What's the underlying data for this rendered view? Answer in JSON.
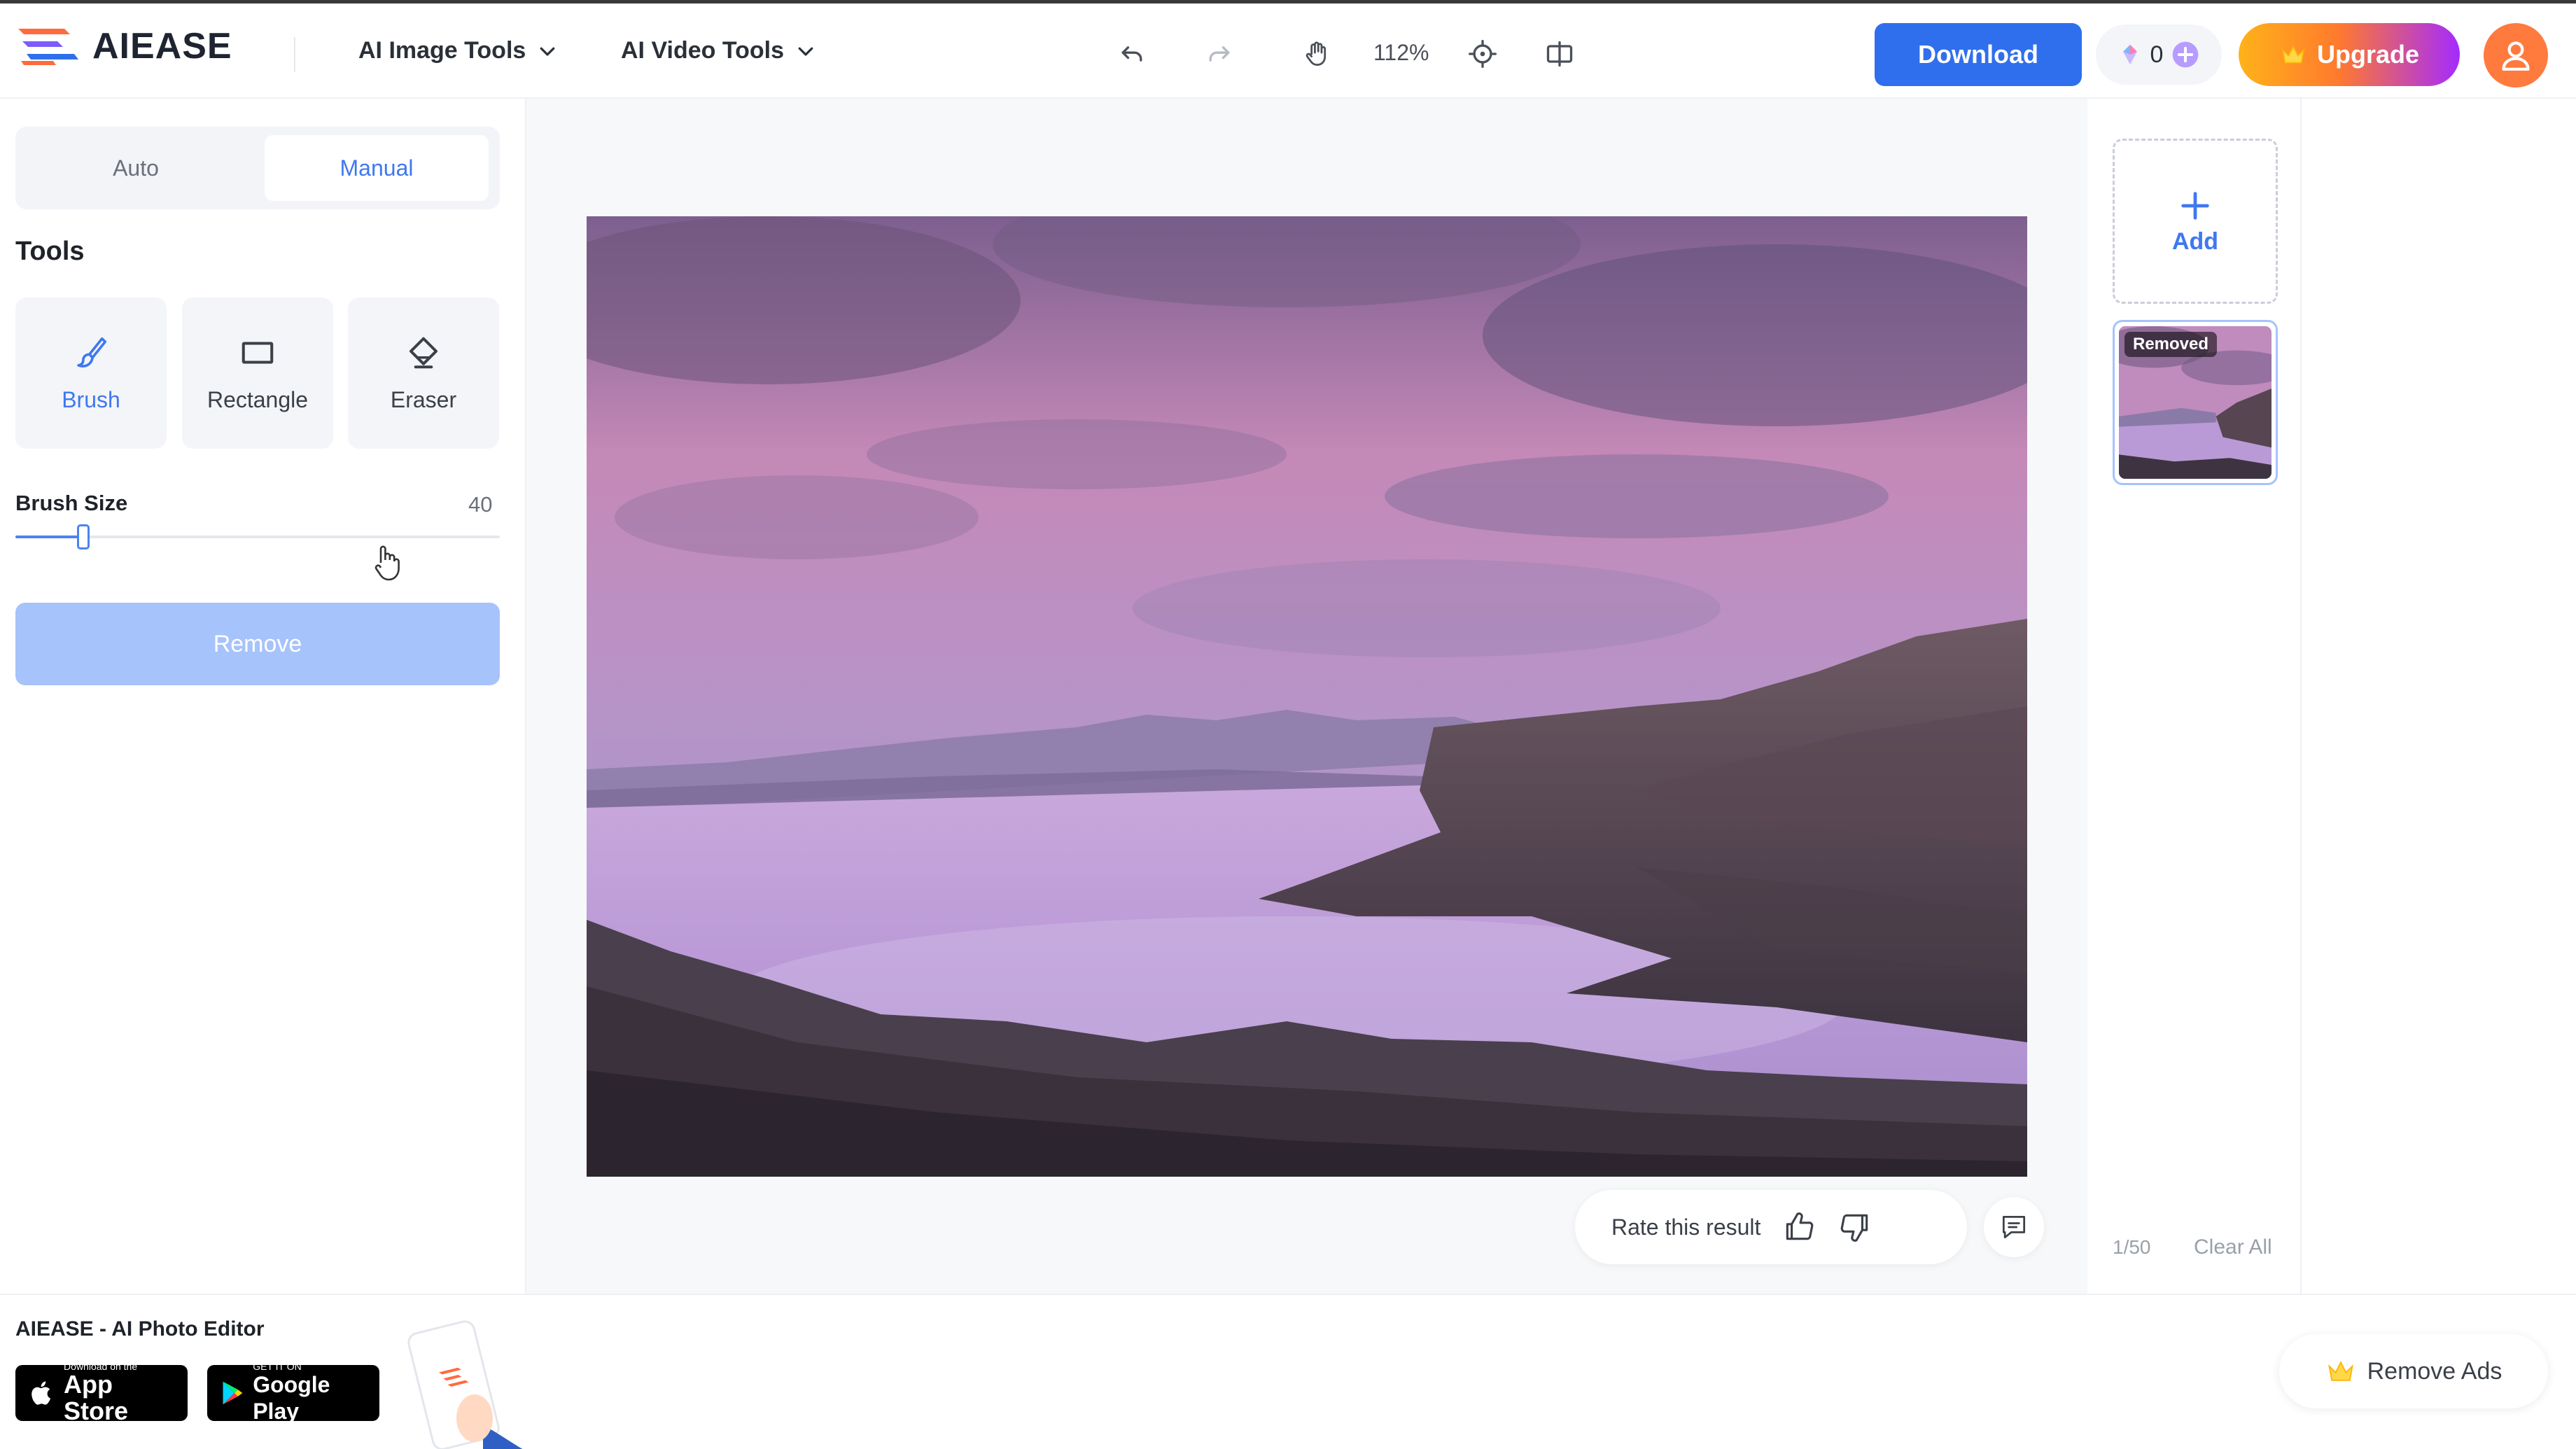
{
  "header": {
    "logo_text": "AIEASE",
    "nav": [
      {
        "label": "AI Image Tools"
      },
      {
        "label": "AI Video Tools"
      }
    ],
    "zoom": "112%",
    "download_label": "Download",
    "credits": "0",
    "upgrade_label": "Upgrade"
  },
  "left_panel": {
    "mode_tabs": [
      {
        "label": "Auto",
        "active": false
      },
      {
        "label": "Manual",
        "active": true
      }
    ],
    "tools_title": "Tools",
    "tools": [
      {
        "label": "Brush",
        "icon": "brush-icon",
        "active": true
      },
      {
        "label": "Rectangle",
        "icon": "rectangle-icon",
        "active": false
      },
      {
        "label": "Eraser",
        "icon": "eraser-icon",
        "active": false
      }
    ],
    "brush_size_label": "Brush Size",
    "brush_size_value": "40",
    "brush_size_fraction": 0.14,
    "remove_label": "Remove"
  },
  "canvas": {
    "rate_label": "Rate this result"
  },
  "right_rail": {
    "add_label": "Add",
    "thumb_badge": "Removed",
    "count": "1/50",
    "clear_all": "Clear All"
  },
  "footer": {
    "app_title": "AIEASE - AI Photo Editor",
    "app_store_small": "Download on the",
    "app_store_big": "App Store",
    "google_small": "GET IT ON",
    "google_big": "Google Play",
    "remove_ads_label": "Remove Ads"
  },
  "colors": {
    "accent": "#2f6fed",
    "accent_light": "#a7c3fb",
    "avatar": "#ff7a3d"
  }
}
